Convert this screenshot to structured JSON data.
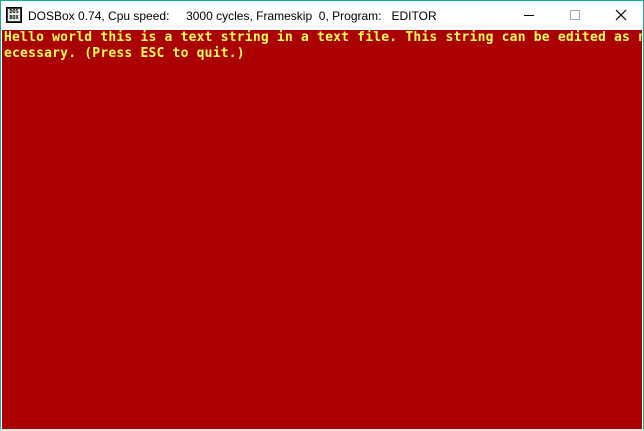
{
  "window": {
    "title": "DOSBox 0.74, Cpu speed:     3000 cycles, Frameskip  0, Program:   EDITOR",
    "icon": "dosbox-icon",
    "icon_label": "DOS BOX"
  },
  "controls": {
    "minimize_icon": "minimize-icon",
    "maximize_icon": "maximize-icon",
    "close_icon": "close-icon"
  },
  "screen": {
    "background_color": "#aa0000",
    "text_color": "#ffff55",
    "lines": [
      "Hello world this is a text string in a text file. This string can be edited as n",
      "ecessary. (Press ESC to quit.)"
    ]
  }
}
